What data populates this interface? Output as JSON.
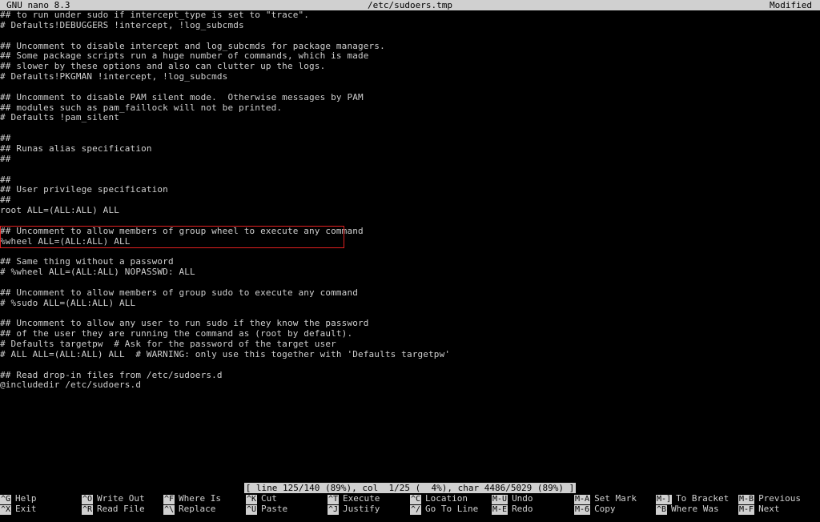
{
  "titlebar": {
    "app": "GNU nano 8.3",
    "filename": "/etc/sudoers.tmp",
    "state": "Modified"
  },
  "editor_lines": [
    "## to run under sudo if intercept_type is set to \"trace\".",
    "# Defaults!DEBUGGERS !intercept, !log_subcmds",
    "",
    "## Uncomment to disable intercept and log_subcmds for package managers.",
    "## Some package scripts run a huge number of commands, which is made",
    "## slower by these options and also can clutter up the logs.",
    "# Defaults!PKGMAN !intercept, !log_subcmds",
    "",
    "## Uncomment to disable PAM silent mode.  Otherwise messages by PAM",
    "## modules such as pam_faillock will not be printed.",
    "# Defaults !pam_silent",
    "",
    "##",
    "## Runas alias specification",
    "##",
    "",
    "##",
    "## User privilege specification",
    "##",
    "root ALL=(ALL:ALL) ALL",
    "",
    "## Uncomment to allow members of group wheel to execute any command",
    "%wheel ALL=(ALL:ALL) ALL",
    "",
    "## Same thing without a password",
    "# %wheel ALL=(ALL:ALL) NOPASSWD: ALL",
    "",
    "## Uncomment to allow members of group sudo to execute any command",
    "# %sudo ALL=(ALL:ALL) ALL",
    "",
    "## Uncomment to allow any user to run sudo if they know the password",
    "## of the user they are running the command as (root by default).",
    "# Defaults targetpw  # Ask for the password of the target user",
    "# ALL ALL=(ALL:ALL) ALL  # WARNING: only use this together with 'Defaults targetpw'",
    "",
    "## Read drop-in files from /etc/sudoers.d",
    "@includedir /etc/sudoers.d"
  ],
  "status": "[ line 125/140 (89%), col  1/25 (  4%), char 4486/5029 (89%) ]",
  "shortcuts_row1": [
    {
      "key": "^G",
      "label": "Help"
    },
    {
      "key": "^O",
      "label": "Write Out"
    },
    {
      "key": "^F",
      "label": "Where Is"
    },
    {
      "key": "^K",
      "label": "Cut"
    },
    {
      "key": "^T",
      "label": "Execute"
    },
    {
      "key": "^C",
      "label": "Location"
    },
    {
      "key": "M-U",
      "label": "Undo"
    },
    {
      "key": "M-A",
      "label": "Set Mark"
    },
    {
      "key": "M-]",
      "label": "To Bracket"
    },
    {
      "key": "M-B",
      "label": "Previous"
    }
  ],
  "shortcuts_row2": [
    {
      "key": "^X",
      "label": "Exit"
    },
    {
      "key": "^R",
      "label": "Read File"
    },
    {
      "key": "^\\",
      "label": "Replace"
    },
    {
      "key": "^U",
      "label": "Paste"
    },
    {
      "key": "^J",
      "label": "Justify"
    },
    {
      "key": "^/",
      "label": "Go To Line"
    },
    {
      "key": "M-E",
      "label": "Redo"
    },
    {
      "key": "M-6",
      "label": "Copy"
    },
    {
      "key": "^B",
      "label": "Where Was"
    },
    {
      "key": "M-F",
      "label": "Next"
    }
  ],
  "colors": {
    "background": "#000000",
    "text": "#d0d0d0",
    "inverse_bg": "#d0d0d0",
    "highlight_border": "#e02020"
  }
}
